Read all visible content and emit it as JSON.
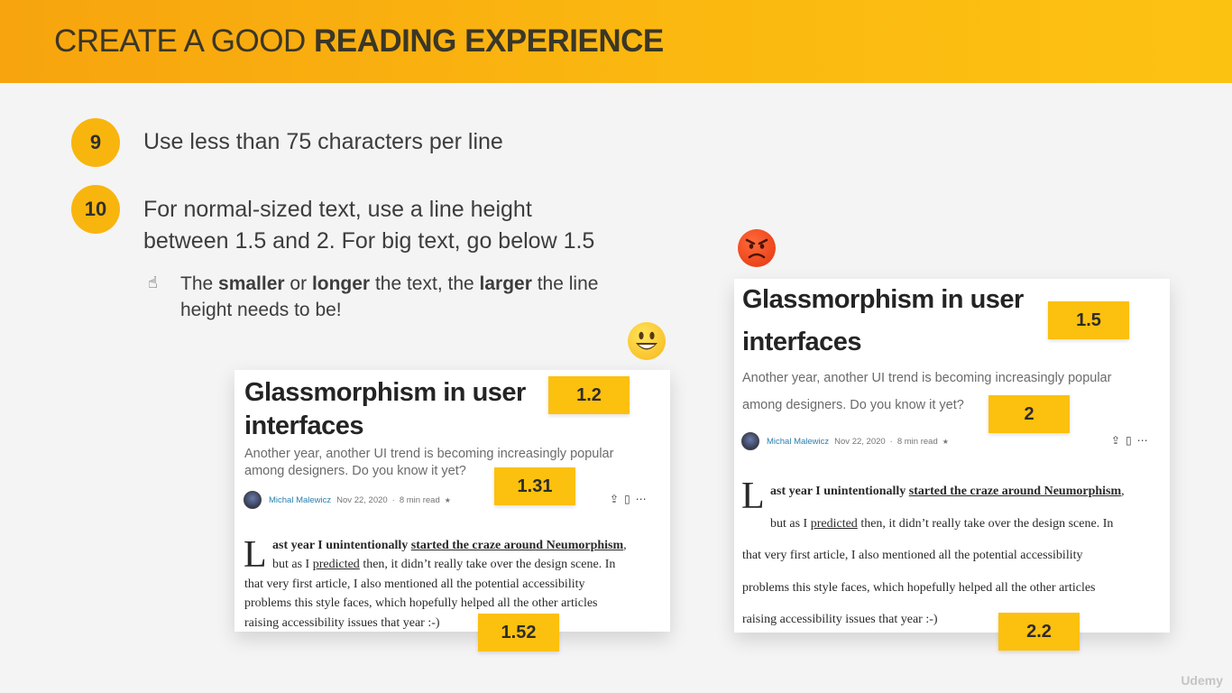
{
  "header": {
    "title_regular": "CREATE A GOOD ",
    "title_bold": "READING EXPERIENCE"
  },
  "rules": [
    {
      "number": "9",
      "text": "Use less than 75 characters per line"
    },
    {
      "number": "10",
      "line1": "For normal-sized text, use a line height",
      "line2": "between 1.5 and 2. For big text, go below 1.5"
    }
  ],
  "tip": {
    "icon": "pointing-up-hand-icon",
    "p1": "The ",
    "b1": "smaller",
    "p2": " or ",
    "b2": "longer",
    "p3": " the text, the ",
    "b3": "larger",
    "p4": " the line",
    "line2": "height needs to be!"
  },
  "emojis": {
    "good": "smiling-face-icon",
    "bad": "angry-face-icon"
  },
  "article": {
    "title_line1": "Glassmorphism in user",
    "title_line2": "interfaces",
    "subtitle_line1": "Another year, another UI trend is becoming increasingly popular",
    "subtitle_line2": "among designers. Do you know it yet?",
    "author": "Michal Malewicz",
    "date": "Nov 22, 2020",
    "read_time": "8 min read",
    "star": "★",
    "dropcap": "L",
    "b1_pre": "ast year I unintentionally ",
    "b1_link": "started the craze around Neumorphism",
    "b1_post": ",",
    "b2_pre": "but as I ",
    "b2_link": "predicted",
    "b2_post": " then, it didn’t really take over the design scene. In",
    "b3": "that very first article, I also mentioned all the potential accessibility",
    "b4": "problems this style faces, which hopefully helped all the other articles",
    "b5": "raising accessibility issues that year :-)"
  },
  "good_example": {
    "title_lh": "1.2",
    "subtitle_lh": "1.31",
    "body_lh": "1.52"
  },
  "bad_example": {
    "title_lh": "1.5",
    "subtitle_lh": "2",
    "body_lh": "2.2"
  },
  "watermark": "Udemy",
  "colors": {
    "accent": "#fbb810",
    "badge": "#fcc00e",
    "link": "#2a7fae"
  }
}
